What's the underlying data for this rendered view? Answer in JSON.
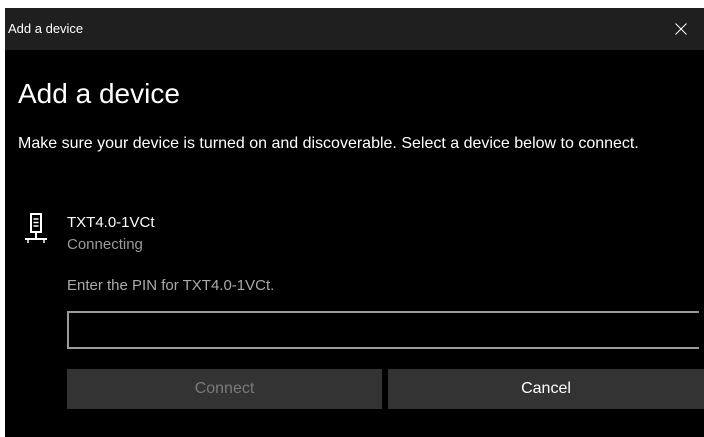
{
  "window": {
    "title": "Add a device"
  },
  "dialog": {
    "heading": "Add a device",
    "description": "Make sure your device is turned on and discoverable. Select a device below to connect."
  },
  "device": {
    "name": "TXT4.0-1VCt",
    "status": "Connecting",
    "icon": "network-device-icon"
  },
  "pin": {
    "prompt": "Enter the PIN for TXT4.0-1VCt.",
    "value": "",
    "placeholder": ""
  },
  "buttons": {
    "connect_label": "Connect",
    "cancel_label": "Cancel"
  },
  "colors": {
    "background": "#000000",
    "titlebar": "#1f1f1f",
    "button": "#333333",
    "disabled_text": "#7a7a7a",
    "secondary_text": "#9a9a9a"
  }
}
